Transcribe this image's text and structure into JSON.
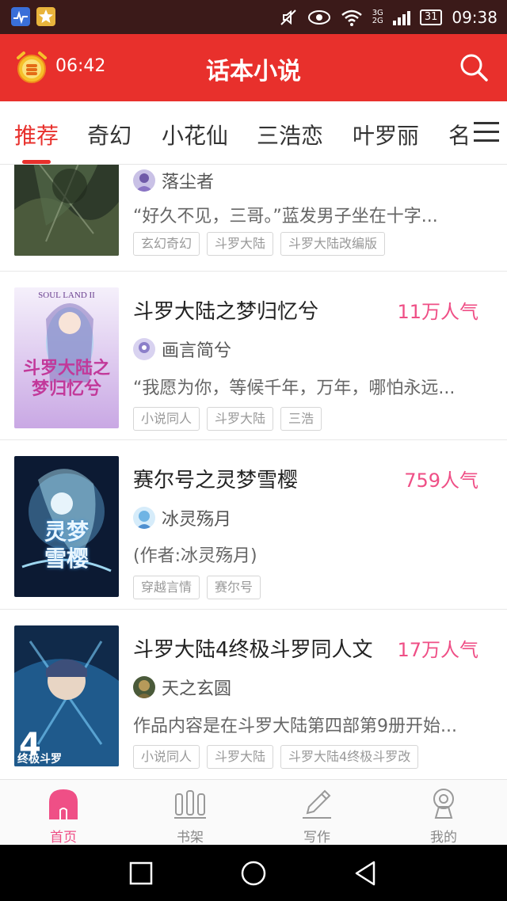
{
  "status_bar": {
    "time": "09:38",
    "battery": "31",
    "network_top": "3G",
    "network_bottom": "2G",
    "icons": [
      "health-app-icon",
      "star-app-icon",
      "mute-icon",
      "eye-icon",
      "wifi-icon",
      "signal-icon"
    ]
  },
  "app_bar": {
    "alarm_time": "06:42",
    "title": "话本小说",
    "search_icon": "search-icon",
    "alarm_icon": "alarm-clock-icon"
  },
  "tabs": {
    "items": [
      {
        "label": "推荐",
        "active": true
      },
      {
        "label": "奇幻"
      },
      {
        "label": "小花仙"
      },
      {
        "label": "三浩恋"
      },
      {
        "label": "叶罗丽"
      },
      {
        "label": "名"
      }
    ],
    "menu_icon": "menu-icon"
  },
  "colors": {
    "primary": "#e8302c",
    "popularity": "#ef4f86",
    "status_bar": "#3b1a19"
  },
  "books": [
    {
      "title": "",
      "popularity": "",
      "author": "落尘者",
      "desc": "“好久不见，三哥。”蓝发男子坐在十字...",
      "tags": [
        "玄幻奇幻",
        "斗罗大陆",
        "斗罗大陆改编版"
      ]
    },
    {
      "title": "斗罗大陆之梦归忆兮",
      "popularity": "11万人气",
      "author": "画言简兮",
      "desc": "“我愿为你，等候千年，万年，哪怕永远...",
      "tags": [
        "小说同人",
        "斗罗大陆",
        "三浩"
      ],
      "cover_text": [
        "SOUL LAND II",
        "斗罗大陆之",
        "梦归忆兮"
      ]
    },
    {
      "title": "赛尔号之灵梦雪樱",
      "popularity": "759人气",
      "author": "冰灵殇月",
      "desc": "(作者:冰灵殇月)",
      "tags": [
        "穿越言情",
        "赛尔号"
      ],
      "cover_text": [
        "灵梦",
        "雪樱"
      ]
    },
    {
      "title": "斗罗大陆4终极斗罗同人文",
      "popularity": "17万人气",
      "author": "天之玄圆",
      "desc": "作品内容是在斗罗大陆第四部第9册开始...",
      "tags": [
        "小说同人",
        "斗罗大陆",
        "斗罗大陆4终极斗罗改"
      ],
      "cover_text": [
        "终极斗罗",
        "4"
      ]
    }
  ],
  "bottom_nav": [
    {
      "label": "首页",
      "icon": "home-icon",
      "active": true
    },
    {
      "label": "书架",
      "icon": "bookshelf-icon"
    },
    {
      "label": "写作",
      "icon": "pen-icon"
    },
    {
      "label": "我的",
      "icon": "profile-icon"
    }
  ],
  "system_nav": [
    "recents-button",
    "home-circle-button",
    "back-button"
  ]
}
